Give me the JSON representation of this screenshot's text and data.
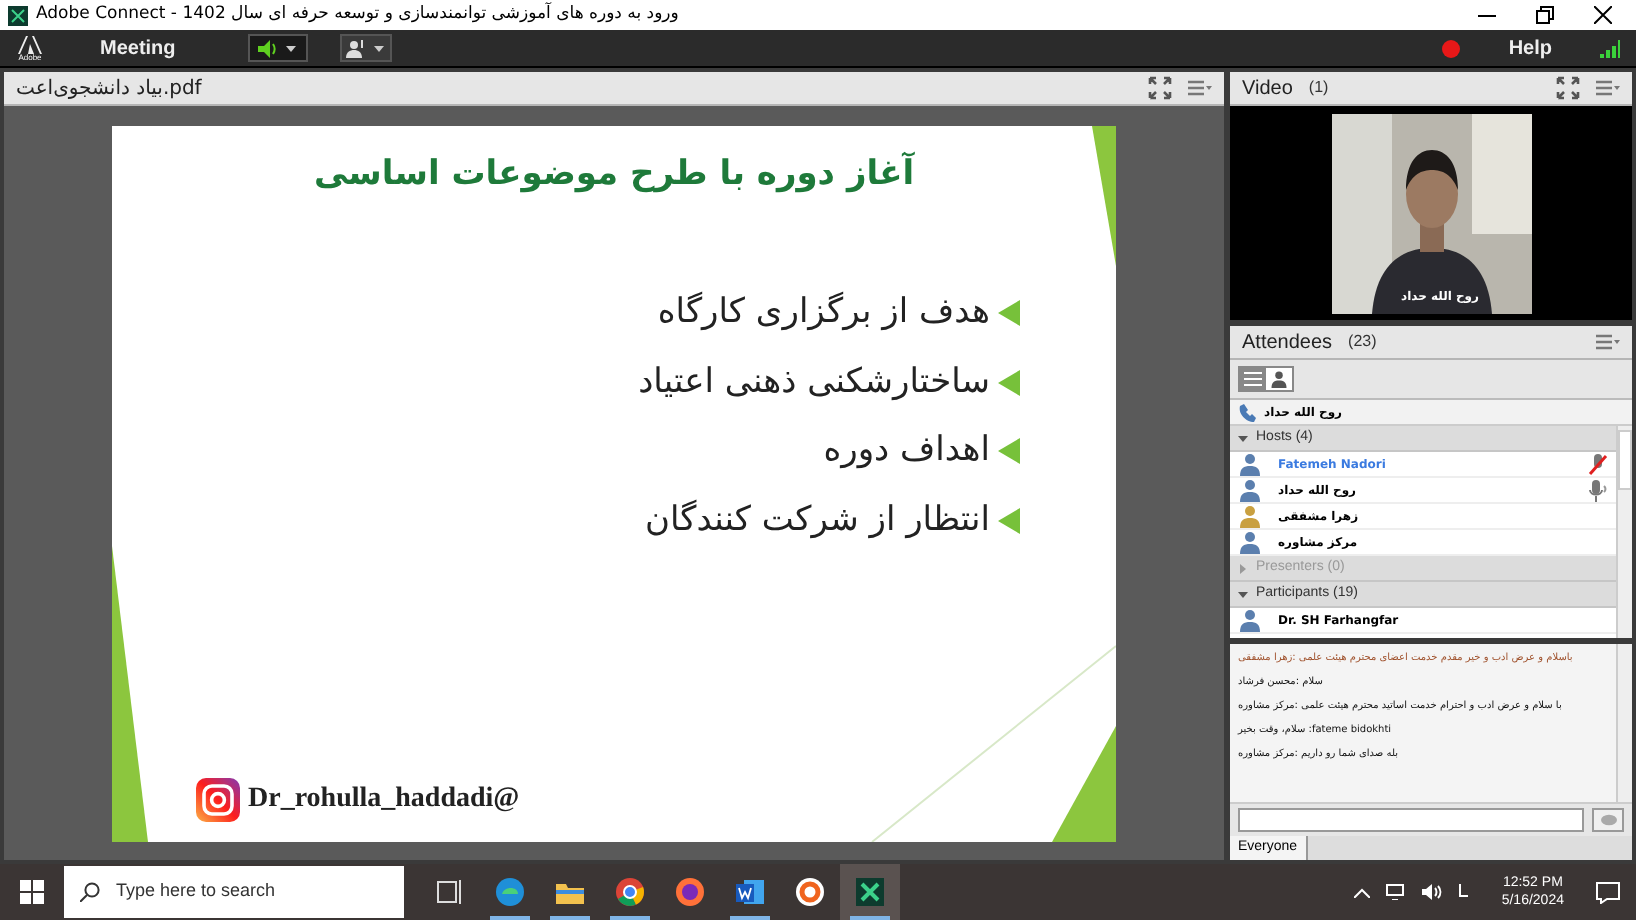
{
  "window": {
    "title": "ورود به دوره های آموزشی توانمندسازی و توسعه حرفه ای سال 1402 - Adobe Connect"
  },
  "menu": {
    "logo": "Adobe",
    "items": [
      "Meeting"
    ],
    "help": "Help",
    "recording": true
  },
  "share_pod": {
    "title": "بیاد دانشجوی‌اعت.pdf"
  },
  "slide": {
    "title": "آغاز دوره با طرح موضوعات اساسی",
    "bullets": [
      "هدف از برگزاری کارگاه",
      "ساختارشکنی ذهنی اعتیاد",
      "اهداف دوره",
      "انتظار از شرکت کنندگان"
    ],
    "handle": "Dr_rohulla_haddadi@"
  },
  "video_pod": {
    "title": "Video",
    "count": "(1)",
    "caption": "روح الله حداد"
  },
  "attendees": {
    "title": "Attendees",
    "count": "(23)",
    "views": [
      {
        "kind": "list",
        "selected": true
      },
      {
        "kind": "detail",
        "selected": false
      }
    ],
    "speaker": "روح الله حداد",
    "groups": [
      {
        "label": "Hosts (4)",
        "expanded": true,
        "members": [
          {
            "name": "Fatemeh Nadori",
            "highlighted": true,
            "mic_muted": true,
            "mic_on": false
          },
          {
            "name": "روح الله حداد",
            "highlighted": false,
            "mic_muted": false,
            "mic_on": true
          },
          {
            "name": "زهرا مشفقی",
            "highlighted": false,
            "mic_muted": false,
            "mic_on": false
          },
          {
            "name": "مرکز مشاوره",
            "highlighted": false,
            "mic_muted": false,
            "mic_on": false
          }
        ]
      },
      {
        "label": "Presenters (0)",
        "expanded": false
      },
      {
        "label": "Participants (19)",
        "expanded": true,
        "members": [
          {
            "name": "Dr. SH Farhangfar",
            "highlighted": false,
            "mic_muted": false,
            "mic_on": false
          }
        ]
      }
    ]
  },
  "chat": {
    "messages": [
      {
        "text": "باسلام و عرض ادب و خیر مقدم خدمت اعضای محترم هیئت علمی :زهرا مشفقی",
        "highlighted": true
      },
      {
        "text": "سلام :محسن فرشاد",
        "highlighted": false
      },
      {
        "text": "با سلام و عرض ادب و احترام خدمت اساتید محترم هیئت علمی :مرکز مشاوره",
        "highlighted": false
      },
      {
        "text": "fateme bidokhti: سلام، وقت بخیر",
        "highlighted": false
      },
      {
        "text": "بله صدای شما رو داریم :مرکز مشاوره",
        "highlighted": false
      }
    ],
    "audience": "Everyone"
  },
  "taskbar": {
    "search_placeholder": "Type here to search",
    "time": "12:52 PM",
    "date": "5/16/2024",
    "apps": [
      {
        "kind": "taskview",
        "running": false,
        "selected": false
      },
      {
        "kind": "edge",
        "running": true,
        "selected": false
      },
      {
        "kind": "explorer",
        "running": true,
        "selected": false
      },
      {
        "kind": "chrome",
        "running": true,
        "selected": false
      },
      {
        "kind": "firefox",
        "running": false,
        "selected": false
      },
      {
        "kind": "word",
        "running": true,
        "selected": false
      },
      {
        "kind": "ring",
        "running": false,
        "selected": false
      },
      {
        "kind": "connect",
        "running": true,
        "selected": true
      }
    ]
  }
}
